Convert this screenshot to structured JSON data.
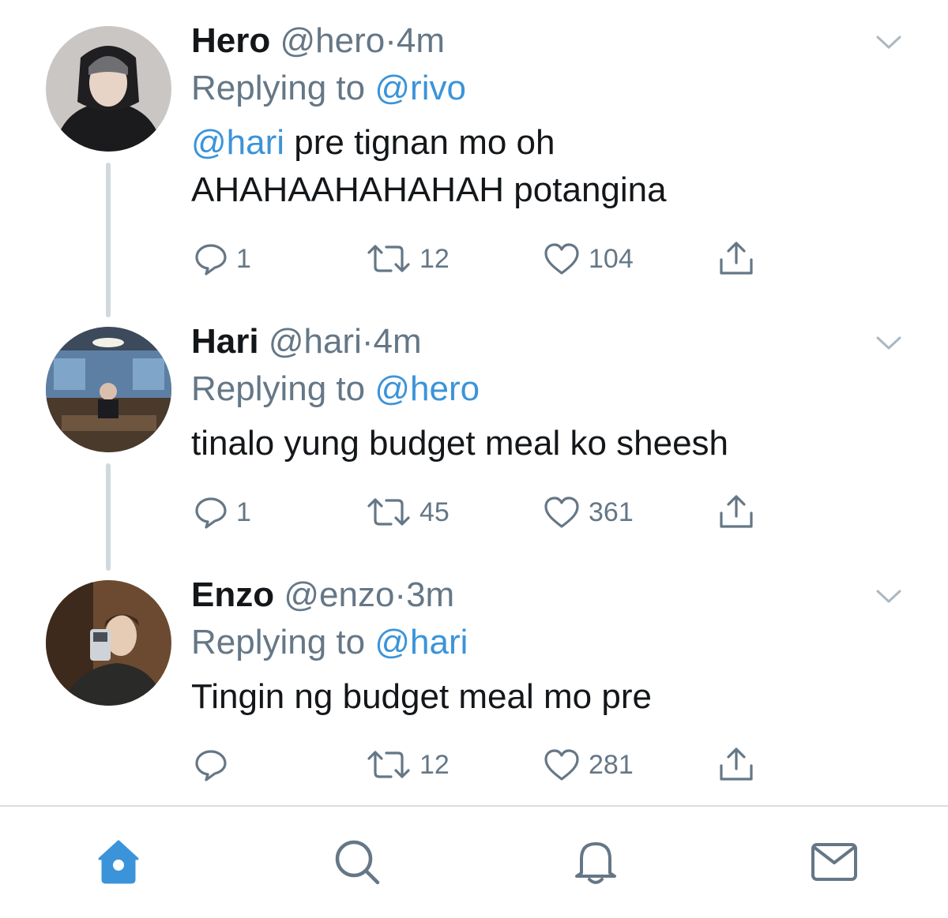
{
  "colors": {
    "accent": "#3b94d9",
    "text_primary": "#14171a",
    "text_secondary": "#657786",
    "thread_line": "#cfd9de"
  },
  "tweets": [
    {
      "name": "Hero",
      "handle": "@hero",
      "separator": "·",
      "time": "4m",
      "replying_prefix": "Replying to",
      "replying_to": "@rivo",
      "mention": "@hari",
      "text_after_mention": " pre tignan mo oh",
      "text_line2": "AHAHAAHAHAHAH potangina",
      "replies": "1",
      "retweets": "12",
      "likes": "104"
    },
    {
      "name": "Hari",
      "handle": "@hari",
      "separator": "·",
      "time": "4m",
      "replying_prefix": "Replying to",
      "replying_to": "@hero",
      "text": "tinalo yung budget meal ko sheesh",
      "replies": "1",
      "retweets": "45",
      "likes": "361"
    },
    {
      "name": "Enzo",
      "handle": "@enzo",
      "separator": "·",
      "time": "3m",
      "replying_prefix": "Replying to",
      "replying_to": "@hari",
      "text": "Tingin ng budget meal mo pre",
      "replies": "",
      "retweets": "12",
      "likes": "281"
    }
  ],
  "tabbar": {
    "tabs": [
      {
        "icon": "home-icon",
        "active": true
      },
      {
        "icon": "search-icon",
        "active": false
      },
      {
        "icon": "bell-icon",
        "active": false
      },
      {
        "icon": "mail-icon",
        "active": false
      }
    ]
  }
}
